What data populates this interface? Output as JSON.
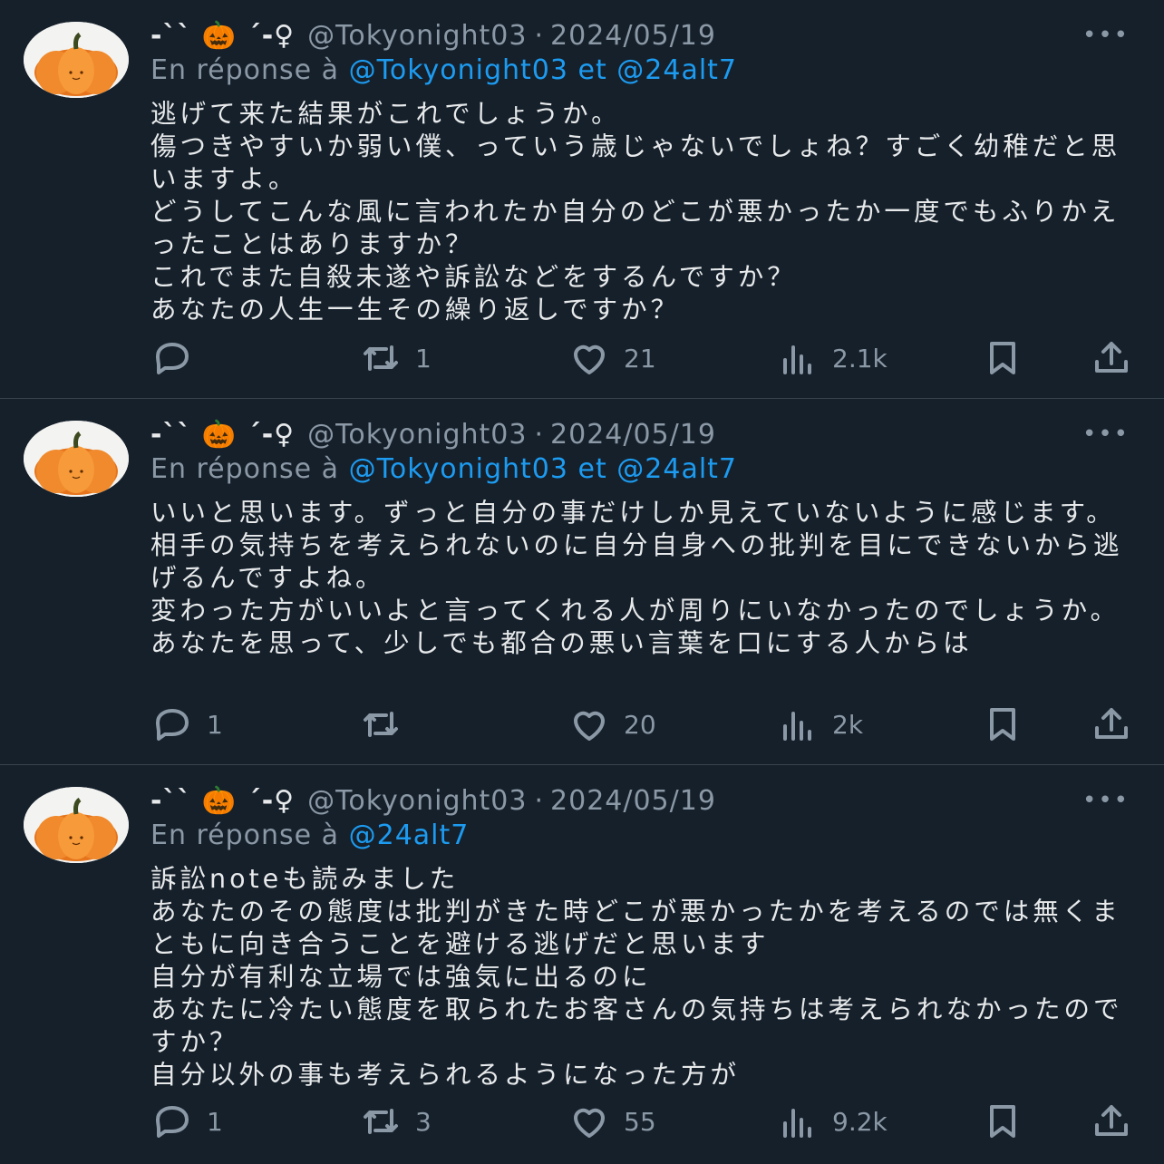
{
  "tweets": [
    {
      "name": "-`` 🎃 ´-♀︎",
      "handle": "@Tokyonight03",
      "separator": "·",
      "date": "2024/05/19",
      "reply_prefix": "En réponse à",
      "reply_mention_1": "@Tokyonight03",
      "reply_and": "et",
      "reply_mention_2": "@24alt7",
      "body": "逃げて来た結果がこれでしょうか。\n傷つきやすいか弱い僕、っていう歳じゃないでしょね？すごく幼稚だと思いますよ。\nどうしてこんな風に言われたか自分のどこが悪かったか一度でもふりかえったことはありますか？\nこれでまた自殺未遂や訴訟などをするんですか？\nあなたの人生一生その繰り返しですか？",
      "replies": "",
      "retweets": "1",
      "likes": "21",
      "views": "2.1k"
    },
    {
      "name": "-`` 🎃 ´-♀︎",
      "handle": "@Tokyonight03",
      "separator": "·",
      "date": "2024/05/19",
      "reply_prefix": "En réponse à",
      "reply_mention_1": "@Tokyonight03",
      "reply_and": "et",
      "reply_mention_2": "@24alt7",
      "body": "いいと思います。ずっと自分の事だけしか見えていないように感じます。相手の気持ちを考えられないのに自分自身への批判を目にできないから逃げるんですよね。\n変わった方がいいよと言ってくれる人が周りにいなかったのでしょうか。あなたを思って、少しでも都合の悪い言葉を口にする人からは",
      "replies": "1",
      "retweets": "",
      "likes": "20",
      "views": "2k"
    },
    {
      "name": "-`` 🎃 ´-♀︎",
      "handle": "@Tokyonight03",
      "separator": "·",
      "date": "2024/05/19",
      "reply_prefix": "En réponse à",
      "reply_mention_1": "@24alt7",
      "reply_and": "",
      "reply_mention_2": "",
      "body": "訴訟noteも読みました\nあなたのその態度は批判がきた時どこが悪かったかを考えるのでは無くまともに向き合うことを避ける逃げだと思います\n自分が有利な立場では強気に出るのに\nあなたに冷たい態度を取られたお客さんの気持ちは考えられなかったのですか？\n自分以外の事も考えられるようになった方が",
      "replies": "1",
      "retweets": "3",
      "likes": "55",
      "views": "9.2k"
    }
  ],
  "colors": {
    "background": "#15202b",
    "text": "#e7e9ea",
    "muted": "#8b98a5",
    "link": "#1d9bf0",
    "divider": "#38444d"
  },
  "icons": [
    "reply-icon",
    "retweet-icon",
    "like-icon",
    "views-icon",
    "bookmark-icon",
    "share-icon",
    "more-icon"
  ]
}
